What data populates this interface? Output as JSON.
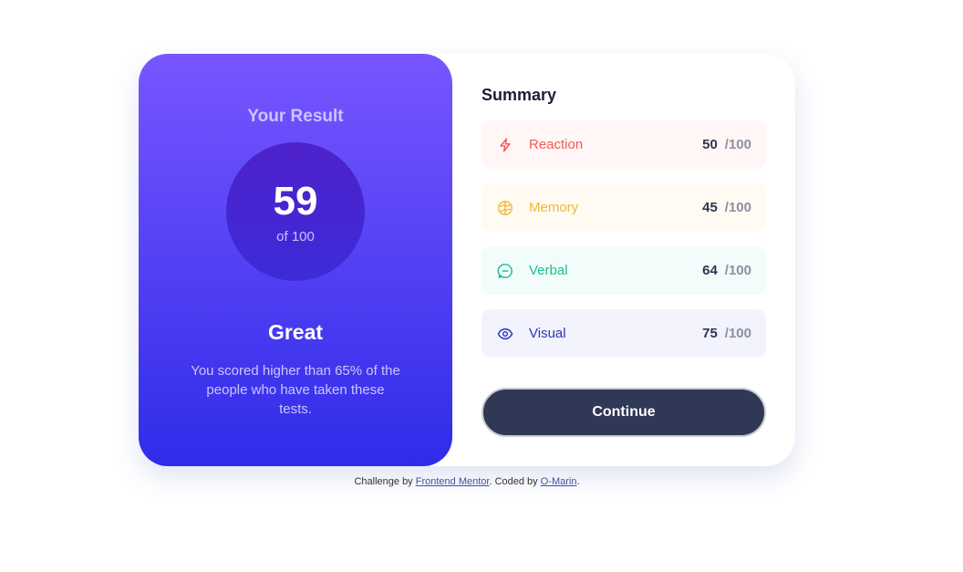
{
  "result": {
    "title": "Your Result",
    "score": "59",
    "of_label": "of 100",
    "verdict": "Great",
    "description": "You scored higher than 65% of the people who have taken these tests."
  },
  "summary": {
    "title": "Summary",
    "rows": [
      {
        "label": "Reaction",
        "score": "50",
        "max": "/100",
        "icon": "lightning-icon",
        "color": "#f45959"
      },
      {
        "label": "Memory",
        "score": "45",
        "max": "/100",
        "icon": "brain-icon",
        "color": "#f5b632"
      },
      {
        "label": "Verbal",
        "score": "64",
        "max": "/100",
        "icon": "chat-icon",
        "color": "#1cc08d"
      },
      {
        "label": "Visual",
        "score": "75",
        "max": "/100",
        "icon": "eye-icon",
        "color": "#2a34b9"
      }
    ],
    "continue_label": "Continue"
  },
  "footer": {
    "prefix": "Challenge by",
    "link1": "Frontend Mentor",
    "middle": ". Coded by",
    "link2": "O-Marin",
    "suffix": "."
  }
}
